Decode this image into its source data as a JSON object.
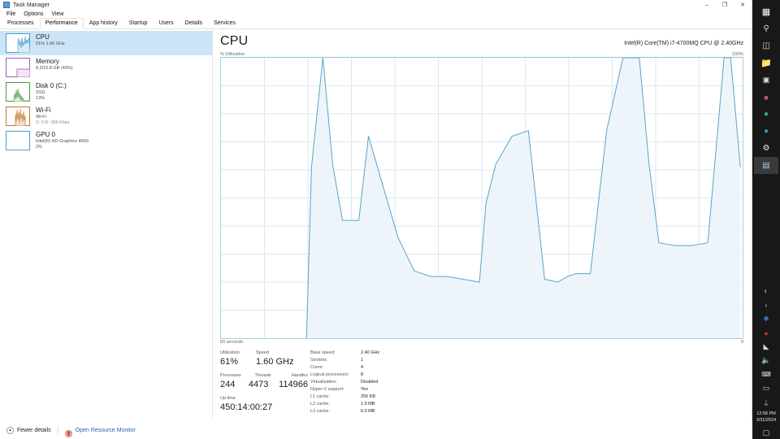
{
  "window": {
    "title": "Task Manager",
    "icon": "task-manager-icon",
    "controls": {
      "minimize": "–",
      "maximize": "❐",
      "close": "✕"
    }
  },
  "menu": {
    "items": [
      "File",
      "Options",
      "View"
    ]
  },
  "tabs": {
    "items": [
      "Processes",
      "Performance",
      "App history",
      "Startup",
      "Users",
      "Details",
      "Services"
    ],
    "active": "Performance"
  },
  "sidebar": {
    "items": [
      {
        "name": "cpu",
        "title": "CPU",
        "sub1": "61% 1.60 GHz",
        "sub2": "",
        "selected": true,
        "color": "#4a9fd5"
      },
      {
        "name": "memory",
        "title": "Memory",
        "sub1": "6.3/15.8 GB (40%)",
        "sub2": "",
        "selected": false,
        "color": "#a05fb4"
      },
      {
        "name": "disk",
        "title": "Disk 0 (C:)",
        "sub1": "SSD",
        "sub2": "13%",
        "selected": false,
        "color": "#4a9b4a"
      },
      {
        "name": "wifi",
        "title": "Wi-Fi",
        "sub1": "Wi-Fi",
        "sub2": "S: 0 R: 288 Kbps",
        "selected": false,
        "color": "#c07a30"
      },
      {
        "name": "gpu",
        "title": "GPU 0",
        "sub1": "Intel(R) HD Graphics 4600",
        "sub2": "2%",
        "selected": false,
        "color": "#4a9fd5"
      }
    ]
  },
  "main": {
    "title": "CPU",
    "subtitle": "Intel(R) Core(TM) i7-4700MQ CPU @ 2.40GHz",
    "axis_top_left": "% Utilization",
    "axis_top_right": "100%",
    "axis_bottom_left": "60 seconds",
    "axis_bottom_right": "0",
    "line_color": "#5aa3c4",
    "fill_color": "#eef5fa",
    "grid_color": "#d7e9f2"
  },
  "stats": {
    "groups": [
      {
        "labels": [
          "Utilization",
          "Speed"
        ],
        "values": [
          "61%",
          "1.60 GHz"
        ]
      },
      {
        "labels": [
          "Processes",
          "Threads",
          "Handles"
        ],
        "values": [
          "244",
          "4473",
          "114966"
        ]
      },
      {
        "labels": [
          "Up time"
        ],
        "values": [
          "450:14:00:27"
        ]
      }
    ],
    "specs": [
      {
        "key": "Base speed:",
        "val": "2.40 GHz"
      },
      {
        "key": "Sockets:",
        "val": "1"
      },
      {
        "key": "Cores:",
        "val": "4"
      },
      {
        "key": "Logical processors:",
        "val": "8"
      },
      {
        "key": "Virtualization:",
        "val": "Disabled"
      },
      {
        "key": "Hyper-V support:",
        "val": "Yes"
      },
      {
        "key": "L1 cache:",
        "val": "256 KB"
      },
      {
        "key": "L2 cache:",
        "val": "1.0 MB"
      },
      {
        "key": "L3 cache:",
        "val": "6.0 MB"
      }
    ]
  },
  "footer": {
    "fewer_details": "Fewer details",
    "resource_monitor": "Open Resource Monitor"
  },
  "taskbar": {
    "items": [
      {
        "name": "start-icon",
        "glyph": "⊞",
        "color": "#ffffff",
        "active": false
      },
      {
        "name": "search-icon",
        "glyph": "⚲",
        "color": "#dddddd",
        "active": false
      },
      {
        "name": "task-view-icon",
        "glyph": "▣",
        "color": "#dddddd",
        "active": false
      },
      {
        "name": "file-explorer-icon",
        "glyph": "▰",
        "color": "#e8b04b",
        "active": false
      },
      {
        "name": "camera-icon",
        "glyph": "■",
        "color": "#e8e8e8",
        "active": false
      },
      {
        "name": "terminal-icon",
        "glyph": "■",
        "color": "#8a3a3a",
        "active": false
      },
      {
        "name": "browser-icon",
        "glyph": "●",
        "color": "#3fae5f",
        "active": false
      },
      {
        "name": "store-icon",
        "glyph": "●",
        "color": "#3f93ae",
        "active": false
      },
      {
        "name": "settings-icon",
        "glyph": "⚙",
        "color": "#e8e8e8",
        "active": false
      },
      {
        "name": "task-manager-icon",
        "glyph": "▤",
        "color": "#9fd0e8",
        "active": true
      }
    ],
    "tray": [
      {
        "name": "security-alert-icon",
        "glyph": "◐",
        "color": "#3f93ae"
      },
      {
        "name": "show-hidden-icons",
        "glyph": "‹",
        "color": "#d8d8d8"
      },
      {
        "name": "onedrive-icon",
        "glyph": "❖",
        "color": "#3f7fd0"
      },
      {
        "name": "antivirus-icon",
        "glyph": "●",
        "color": "#c83030"
      },
      {
        "name": "network-icon",
        "glyph": "◥",
        "color": "#d8d8d8"
      },
      {
        "name": "volume-icon",
        "glyph": "◁",
        "color": "#d8d8d8"
      },
      {
        "name": "keyboard-icon",
        "glyph": "⌨",
        "color": "#d8d8d8"
      },
      {
        "name": "battery-icon",
        "glyph": "▭",
        "color": "#d8d8d8"
      },
      {
        "name": "bluetooth-icon",
        "glyph": "ᛦ",
        "color": "#d8d8d8"
      }
    ],
    "clock": {
      "time": "12:58 PM",
      "date": "3/31/2024"
    },
    "action_center": "▢"
  },
  "chart_data": {
    "type": "area",
    "title": "CPU % Utilization",
    "xlabel": "60 seconds",
    "ylabel": "% Utilization",
    "xlim": [
      0,
      60
    ],
    "ylim": [
      0,
      100
    ],
    "grid": true,
    "note": "Trace begins ~54s ago (left portion of window is blank/no data).",
    "x": [
      54.0,
      54.0,
      54.3,
      55.0,
      55.6,
      56.2,
      56.6,
      57.2,
      57.8,
      58.6,
      59.6,
      60.6,
      61.6,
      62.6,
      63.6,
      64.6,
      65.0,
      65.6,
      66.6,
      67.6,
      68.6,
      69.4,
      70.0,
      70.5,
      71.4,
      72.4,
      73.4,
      74.4,
      75.0,
      75.6,
      76.6,
      77.6,
      78.6,
      79.6,
      80.0,
      80.6
    ],
    "values_desc": "% CPU utilization sampled left-to-right across the visible trace",
    "values": [
      0,
      0,
      61,
      100,
      62,
      42,
      42,
      42,
      72,
      56,
      36,
      24,
      22,
      22,
      21,
      20,
      48,
      62,
      72,
      74,
      21,
      20,
      22,
      23,
      23,
      74,
      100,
      100,
      62,
      34,
      33,
      33,
      34,
      100,
      100,
      61
    ]
  }
}
